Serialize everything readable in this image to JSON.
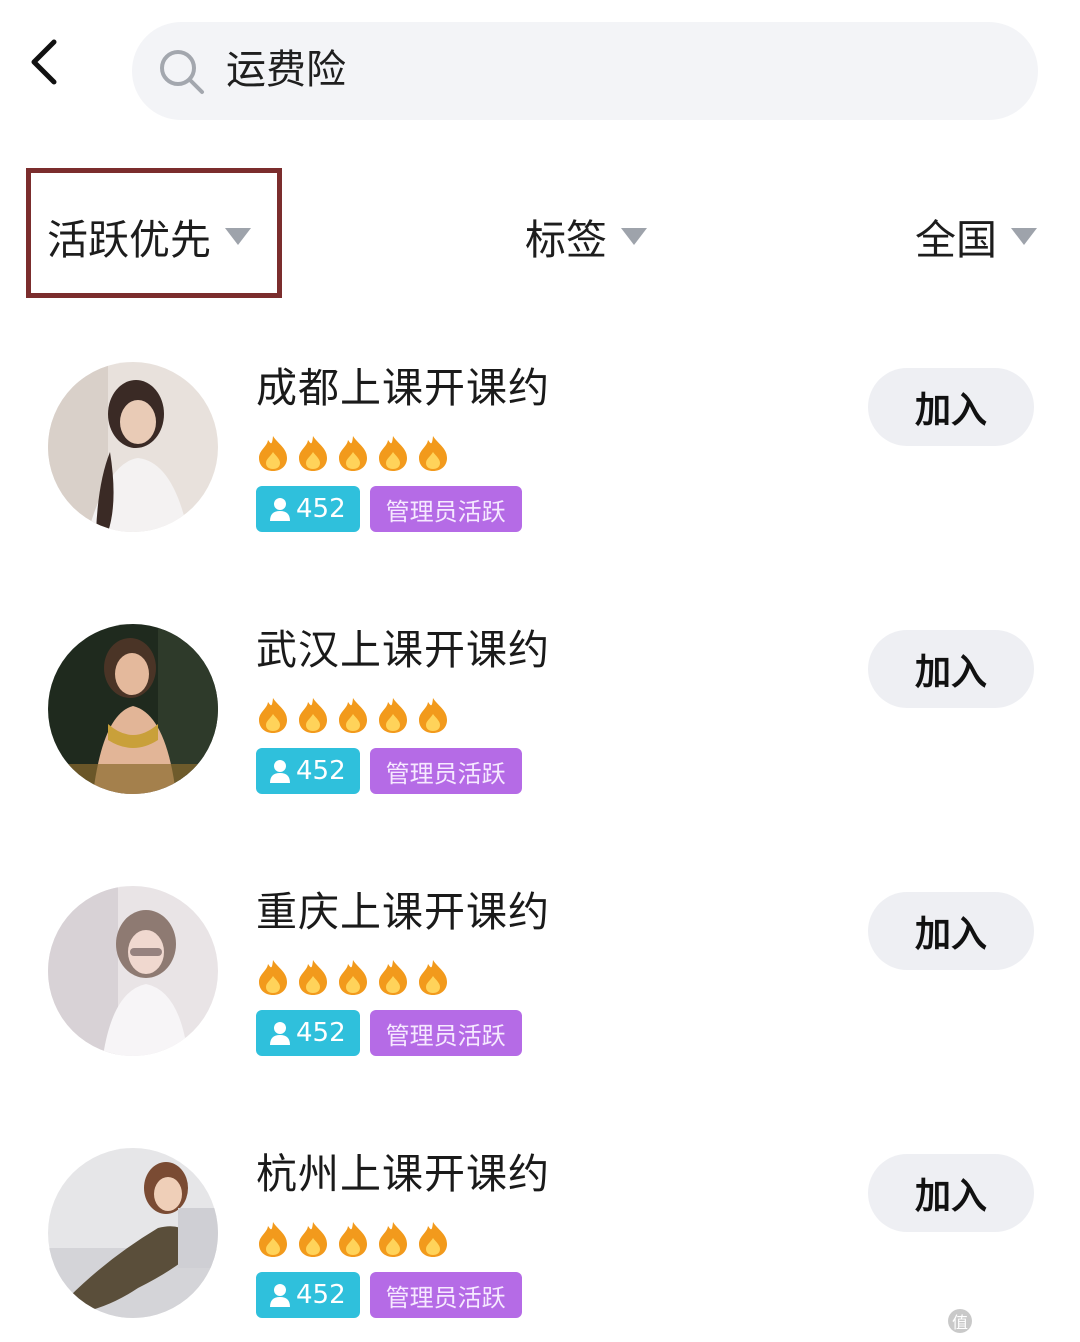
{
  "header": {
    "back_icon": "chevron-left-icon",
    "search": {
      "icon": "search-icon",
      "value": "运费险"
    }
  },
  "filters": {
    "active": {
      "label": "活跃优先",
      "icon": "caret-down-icon"
    },
    "tag": {
      "label": "标签",
      "icon": "caret-down-icon"
    },
    "region": {
      "label": "全国",
      "icon": "caret-down-icon"
    },
    "highlight_color": "#7b2d2d"
  },
  "groups": [
    {
      "title": "成都上课开课约",
      "rating": 5,
      "members": "452",
      "admin_badge": "管理员活跃",
      "join_label": "加入"
    },
    {
      "title": "武汉上课开课约",
      "rating": 5,
      "members": "452",
      "admin_badge": "管理员活跃",
      "join_label": "加入"
    },
    {
      "title": "重庆上课开课约",
      "rating": 5,
      "members": "452",
      "admin_badge": "管理员活跃",
      "join_label": "加入"
    },
    {
      "title": "杭州上课开课约",
      "rating": 5,
      "members": "452",
      "admin_badge": "管理员活跃",
      "join_label": "加入"
    }
  ],
  "colors": {
    "members_badge": "#2fc0dc",
    "admin_badge": "#b56be6",
    "flame": "#f29a1c",
    "join_button_bg": "#eeeff3"
  },
  "watermark": {
    "text": "什么值得买"
  }
}
